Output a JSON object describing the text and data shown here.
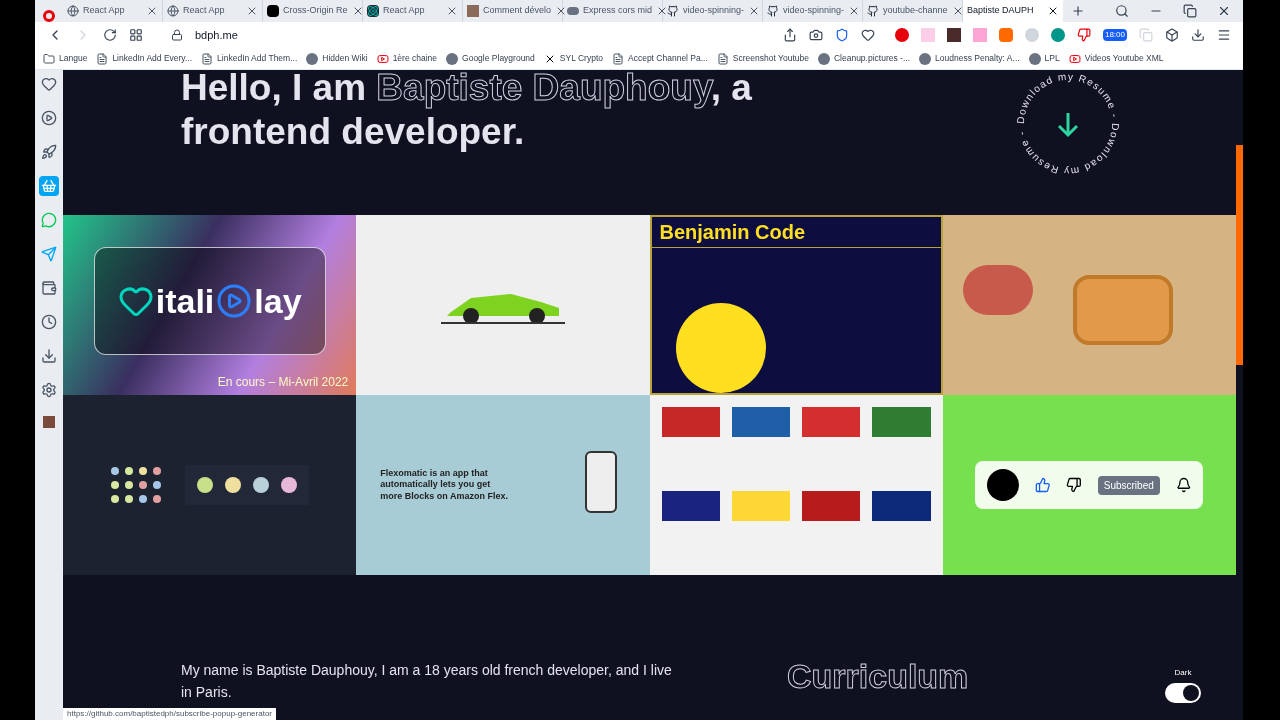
{
  "tabs": [
    {
      "title": "React App",
      "selected": false
    },
    {
      "title": "React App",
      "selected": false
    },
    {
      "title": "Cross-Origin Re",
      "selected": false
    },
    {
      "title": "React App",
      "selected": false
    },
    {
      "title": "Comment dévelo",
      "selected": false
    },
    {
      "title": "Express cors mid",
      "selected": false
    },
    {
      "title": "video-spinning-",
      "selected": false
    },
    {
      "title": "video-spinning-",
      "selected": false
    },
    {
      "title": "youtube-channe",
      "selected": false
    },
    {
      "title": "Baptiste DAUPH",
      "selected": true
    }
  ],
  "address": "bdph.me",
  "extension_badge": "18:00",
  "bookmarks": [
    "Langue",
    "LinkedIn Add Every...",
    "LinkedIn Add Them...",
    "Hidden Wiki",
    "1ère chaine",
    "Google Playground",
    "SYL Crypto",
    "Accept Channel Pa...",
    "Screenshot Youtube",
    "Cleanup.pictures -...",
    "Loudness Penalty: A...",
    "LPL",
    "Videos Youtube XML"
  ],
  "sidebar": [
    {
      "selected": false
    },
    {
      "selected": false
    },
    {
      "selected": false
    },
    {
      "selected": true
    },
    {
      "selected": false
    },
    {
      "selected": false
    },
    {
      "selected": false
    },
    {
      "selected": false
    },
    {
      "selected": false
    },
    {
      "selected": false
    },
    {
      "selected": false
    }
  ],
  "hero": {
    "line_1_start": "Hello, I am ",
    "line_1_name": "Baptiste Dauphouy",
    "line_1_end": ", a",
    "line_2": "frontend developer.",
    "resume_ring": "Download my Resume - Download my Resume - "
  },
  "projects": [
    {
      "kind": "vitaliplay",
      "logo_text": "itali",
      "logo_text_2": "lay",
      "caption": "En cours – Mi-Avril 2022"
    },
    {
      "kind": "car"
    },
    {
      "kind": "benjamin",
      "title": "Benjamin Code"
    },
    {
      "kind": "game"
    },
    {
      "kind": "colors"
    },
    {
      "kind": "flexomatic",
      "text": "Flexomatic is an app that automatically lets you get more Blocks on Amazon Flex."
    },
    {
      "kind": "flags"
    },
    {
      "kind": "subscribe",
      "button": "Subscribed"
    }
  ],
  "about": {
    "text": "My name is Baptiste Dauphouy, I am a 18 years old french developer, and I live in Paris.",
    "section_title": "Curriculum",
    "theme_label": "Dark",
    "theme_dark": true
  },
  "status_url": "https://github.com/baptistedph/subscribe-popup-generator"
}
